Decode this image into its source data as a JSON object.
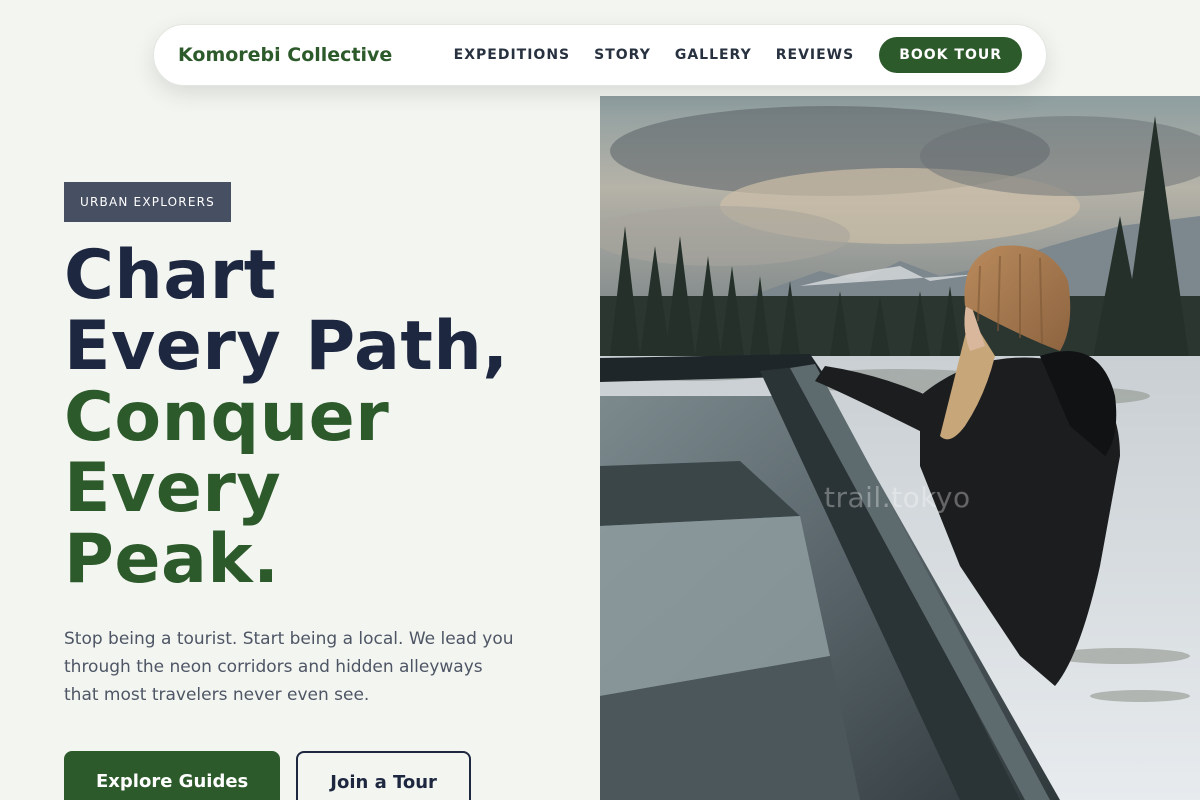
{
  "nav": {
    "brand": "Komorebi Collective",
    "links": [
      "EXPEDITIONS",
      "STORY",
      "GALLERY",
      "REVIEWS"
    ],
    "cta": "BOOK TOUR"
  },
  "hero": {
    "badge": "URBAN EXPLORERS",
    "headline_dark": [
      "Chart",
      "Every Path,"
    ],
    "headline_green": [
      "Conquer",
      "Every",
      "Peak."
    ],
    "lead": "Stop being a tourist. Start being a local. We lead you through the neon corridors and hidden alleyways that most travelers never even see.",
    "primary_cta": "Explore Guides",
    "secondary_cta": "Join a Tour",
    "image_watermark": "trail.tokyo"
  },
  "colors": {
    "brand_green": "#2d5a2b",
    "navy": "#1e2740",
    "badge_bg": "#474f63",
    "page_bg": "#f3f5f1"
  }
}
